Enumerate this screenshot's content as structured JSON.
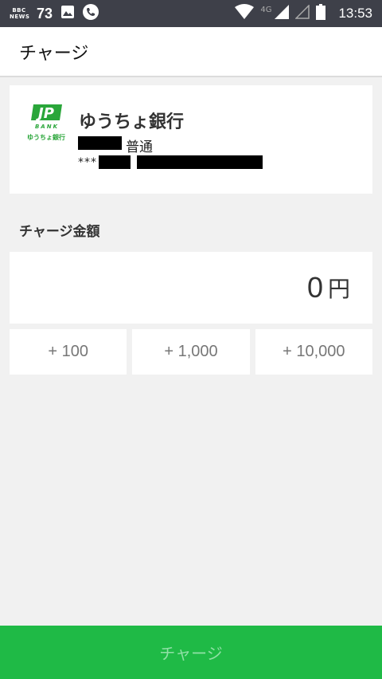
{
  "status_bar": {
    "bbc_line1": "BBC",
    "bbc_line2": "NEWS",
    "notification_count": "73",
    "network_label": "4G",
    "time": "13:53"
  },
  "header": {
    "title": "チャージ"
  },
  "bank": {
    "logo_text": "JP",
    "logo_sub": "BANK",
    "logo_caption": "ゆうちょ銀行",
    "name": "ゆうちょ銀行",
    "account_type": "普通",
    "account_mask": "***"
  },
  "amount": {
    "section_label": "チャージ金額",
    "value": "0",
    "unit": "円"
  },
  "quick_amounts": [
    "+ 100",
    "+ 1,000",
    "+ 10,000"
  ],
  "charge_button": {
    "label": "チャージ"
  },
  "colors": {
    "accent": "#1fba46",
    "status_bar": "#3e4049"
  }
}
